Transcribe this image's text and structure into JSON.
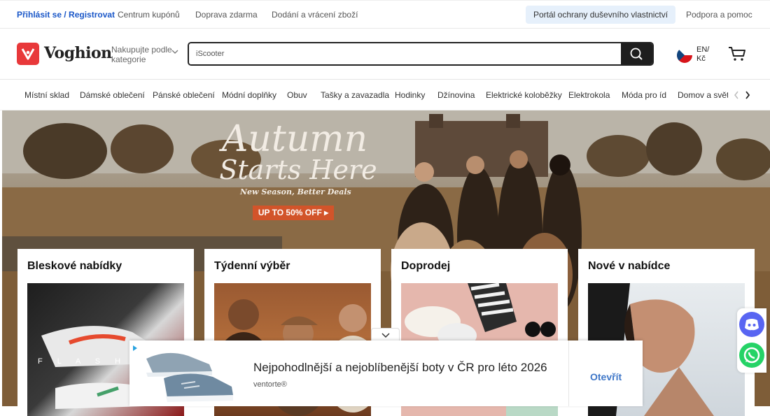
{
  "topbar": {
    "login": "Přihlásit se / Registrovat",
    "coupons": "Centrum kupónů",
    "free_shipping": "Doprava zdarma",
    "delivery": "Dodání a vrácení zboží",
    "ip_portal": "Portál ochrany duševního vlastnictví",
    "support": "Podpora a pomoc"
  },
  "header": {
    "logo": "Voghion",
    "category_label": "Nakupujte podle kategorie",
    "search_value": "iScooter",
    "lang": "EN/",
    "currency": "Kč"
  },
  "categories": [
    "Místní sklad",
    "Dámské oblečení",
    "Pánské oblečení",
    "Módní doplňky",
    "Obuv",
    "Tašky a zavazadla",
    "Hodinky",
    "Džínovina",
    "Elektrické koloběžky",
    "Elektrokola",
    "Móda pro íd",
    "Domov a světlo"
  ],
  "banner": {
    "title_line1": "Autumn",
    "title_line2": "Starts Here",
    "subtitle": "New Season, Better Deals",
    "cta": "UP TO 50% OFF ▸"
  },
  "cards": [
    {
      "title": "Bleskové nabídky",
      "overlay": "F L A S H  D"
    },
    {
      "title": "Týdenní výběr"
    },
    {
      "title": "Doprodej"
    },
    {
      "title": "Nové v nabídce"
    }
  ],
  "ad": {
    "title": "Nejpohodlnější a nejoblíbenější boty v ČR pro léto 2026",
    "brand": "ventorte®",
    "open": "Otevřít"
  },
  "colors": {
    "accent_blue": "#1a57c8",
    "brand_red": "#e8383a",
    "cta_orange": "#d2542a",
    "discord": "#5865f2",
    "whatsapp": "#25d366"
  }
}
